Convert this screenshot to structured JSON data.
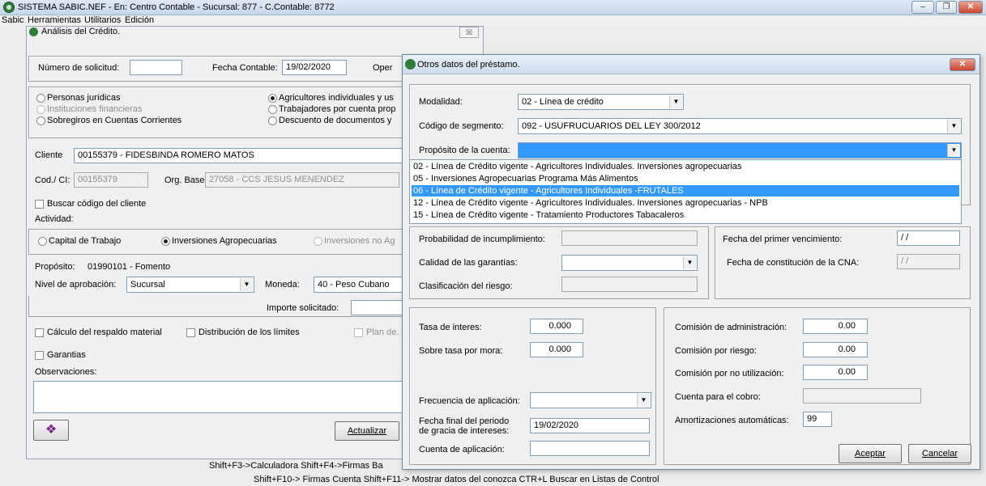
{
  "app": {
    "title": "SISTEMA SABIC.NEF - En: Centro Contable - Sucursal: 877 - C.Contable: 8772",
    "min": "–",
    "max": "❐",
    "close": "✕"
  },
  "menu": [
    "Sabic",
    "Herramientas",
    "Utilitarios",
    "Edición"
  ],
  "credit": {
    "title": "Análisis del Crédito.",
    "close": "☒",
    "num_sol_label": "Número de solicitud:",
    "num_sol_value": "",
    "fecha_label": "Fecha Contable:",
    "fecha_value": "19/02/2020",
    "oper_label": "Oper",
    "radios": {
      "pj": "Personas jurídicas",
      "if": "Instituciones financieras",
      "sc": "Sobregiros en Cuentas Corrientes",
      "ai": "Agricultores individuales y us",
      "tc": "Trabajadores por cuenta prop",
      "dd": "Descuento de documentos y"
    },
    "cliente_label": "Cliente",
    "cliente_value": "00155379 - FIDESBINDA ROMERO MATOS",
    "codci_label": "Cod./ CI:",
    "codci_value": "00155379",
    "org_label": "Org. Base:",
    "org_value": "27058 - CCS  JESUS MENENDEZ",
    "buscar_label": "Buscar código del cliente",
    "actividad_label": "Actividad:",
    "act": {
      "ct": "Capital de Trabajo",
      "ia": "Inversiones Agropecuarias",
      "in": "Inversiones no Ag"
    },
    "proposito_label": "Propósito:",
    "proposito_value": "01990101 - Fomento",
    "nivel_label": "Nivel de aprobación:",
    "nivel_value": "Sucursal",
    "moneda_label": "Moneda:",
    "moneda_value": "40 - Peso Cubano",
    "importe_label": "Importe solicitado:",
    "calculo_label": "Cálculo del respaldo material",
    "distrib_label": "Distribución de los límites",
    "plan_label": "Plan de.",
    "garantias_label": "Garantias",
    "obs_label": "Observaciones:",
    "actualizar": "Actualizar"
  },
  "otros": {
    "title": "Otros datos del préstamo.",
    "close": "✕",
    "modalidad_label": "Modalidad:",
    "modalidad_value": "02 - Línea de crédito",
    "segmento_label": "Código de segmento:",
    "segmento_value": "092 - USUFRUCUARIOS  DEL LEY 300/2012",
    "proposito_label": "Propósito de la cuenta:",
    "options": [
      "02 - Línea de Crédito vigente - Agricultores Individuales. Inversiones agropecuarias",
      "05 - Inversiones Agropecuarias Programa Más Alimentos",
      "06 - Línea de Crédito vigente - Agricultores Individuales -FRUTALES",
      "12 - Línea de Crédito vigente - Agricultores Individuales. Inversiones agropecuarias - NPB",
      "15 - Línea de Crédito vigente - Tratamiento Productores Tabacaleros"
    ],
    "prob_label": "Probabilidad de incumplimiento:",
    "calidad_label": "Calidad de las garantías:",
    "clasif_label": "Clasificación del riesgo:",
    "primer_venc_label": "Fecha del primer vencimiento:",
    "primer_venc_value": "/ /",
    "cna_label": "Fecha de constitución de la CNA:",
    "cna_value": "/ /",
    "tasa_label": "Tasa de interes:",
    "tasa_value": "0.000",
    "sobretasa_label": "Sobre tasa por mora:",
    "sobretasa_value": "0.000",
    "frecuencia_label": "Frecuencia de aplicación:",
    "fecha_final_label1": "Fecha final del periodo",
    "fecha_final_label2": "de gracia de intereses:",
    "fecha_final_value": "19/02/2020",
    "cuenta_apl_label": "Cuenta de aplicación:",
    "com_admin_label": "Comisión de administración:",
    "com_admin_value": "0.00",
    "com_riesgo_label": "Comisión por riesgo:",
    "com_riesgo_value": "0.00",
    "com_noutil_label": "Comisión por no utilización:",
    "com_noutil_value": "0.00",
    "cuenta_cobro_label": "Cuenta para el cobro:",
    "amort_label": "Amortizaciones automáticas:",
    "amort_value": "99",
    "aceptar": "Aceptar",
    "cancelar": "Cancelar"
  },
  "footer": {
    "line1": "Shift+F3->Calculadora  Shift+F4->Firmas Ba",
    "line2": "Shift+F10-> Firmas Cuenta   Shift+F11-> Mostrar datos del conozca   CTR+L Buscar en Listas de Control"
  }
}
